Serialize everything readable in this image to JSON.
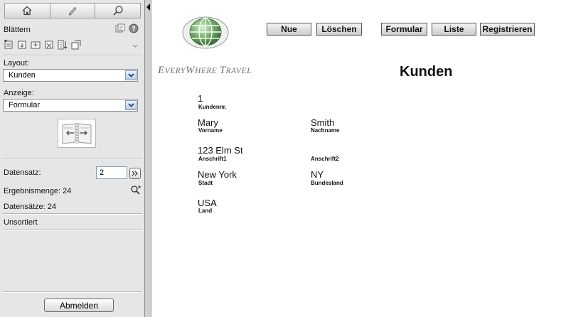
{
  "sidebar": {
    "browse_label": "Blättern",
    "layout_label": "Layout:",
    "layout_value": "Kunden",
    "view_label": "Anzeige:",
    "view_value": "Formular",
    "record_label": "Datensatz:",
    "record_value": "2",
    "found_label": "Ergebnismenge: 24",
    "total_label": "Datensätze: 24",
    "sort_label": "Unsortiert",
    "logout_label": "Abmelden"
  },
  "toolbar": {
    "new_label": "Nue",
    "delete_label": "Löschen",
    "form_label": "Formular",
    "list_label": "Liste",
    "register_label": "Registrieren"
  },
  "brand": {
    "part1_cap": "E",
    "part1_rest": "VERY",
    "part2_cap": "W",
    "part2_rest": "HERE ",
    "part3_cap": "T",
    "part3_rest": "RAVEL"
  },
  "page_title": "Kunden",
  "record": {
    "customer_no": {
      "value": "1",
      "label": "Kundennr."
    },
    "first_name": {
      "value": "Mary",
      "label": "Vorname"
    },
    "last_name": {
      "value": "Smith",
      "label": "Nachname"
    },
    "address1": {
      "value": "123 Elm St",
      "label": "Anschrift1"
    },
    "address2": {
      "value": "",
      "label": "Anschrift2"
    },
    "city": {
      "value": "New York",
      "label": "Stadt"
    },
    "state": {
      "value": "NY",
      "label": "Bundesland"
    },
    "country": {
      "value": "USA",
      "label": "Land"
    }
  },
  "colors": {
    "sidebar_bg": "#e6e6e6",
    "select_button": "#b9cbe6",
    "brand_text": "#6e6e6e",
    "globe_green": "#3f7a3a"
  }
}
